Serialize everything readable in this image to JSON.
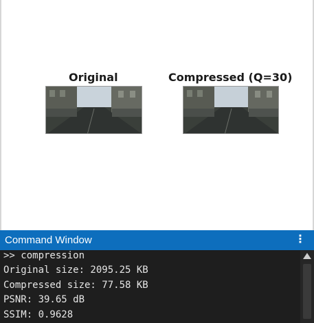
{
  "figure": {
    "panels": [
      {
        "title": "Original"
      },
      {
        "title": "Compressed (Q=30)"
      }
    ]
  },
  "command_window": {
    "title": "Command Window",
    "menu_icon": "vertical-ellipsis-icon",
    "lines": [
      ">> compression",
      "Original size: 2095.25 KB",
      "Compressed size: 77.58 KB",
      "PSNR: 39.65 dB",
      "SSIM: 0.9628"
    ]
  },
  "colors": {
    "header_bg": "#0d6ebd",
    "console_bg": "#1e1e1e",
    "console_text": "#e6e6e6"
  }
}
